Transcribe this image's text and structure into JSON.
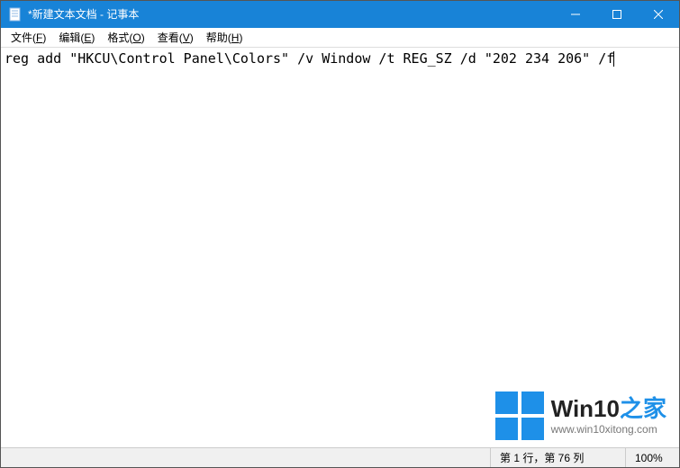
{
  "window": {
    "title": "*新建文本文档 - 记事本"
  },
  "menus": {
    "file": {
      "label": "文件",
      "accel": "F"
    },
    "edit": {
      "label": "编辑",
      "accel": "E"
    },
    "format": {
      "label": "格式",
      "accel": "O"
    },
    "view": {
      "label": "查看",
      "accel": "V"
    },
    "help": {
      "label": "帮助",
      "accel": "H"
    }
  },
  "editor": {
    "content": "reg add \"HKCU\\Control Panel\\Colors\" /v Window /t REG_SZ /d \"202 234 206\" /f"
  },
  "statusbar": {
    "position": "第 1 行，第 76 列",
    "zoom": "100%"
  },
  "watermark": {
    "title_main": "Win10",
    "title_suffix": "之家",
    "url": "www.win10xitong.com"
  }
}
